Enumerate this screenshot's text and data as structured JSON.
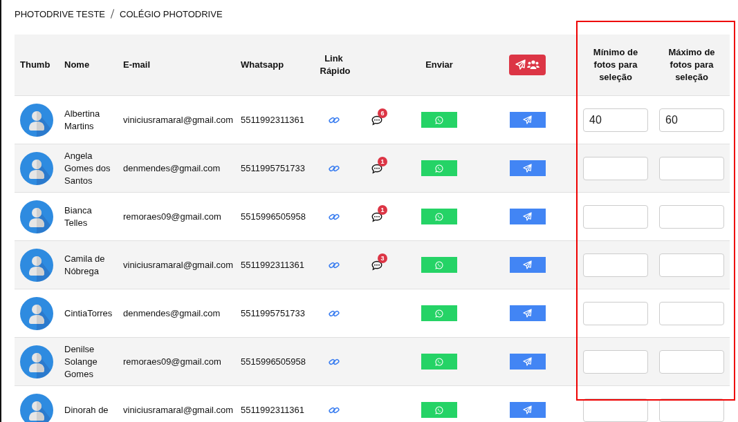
{
  "breadcrumb": [
    "PHOTODRIVE TESTE",
    "COLÉGIO PHOTODRIVE"
  ],
  "table": {
    "columns": [
      "Thumb",
      "Nome",
      "E-mail",
      "Whatsapp",
      "Link Rápido",
      "",
      "Enviar",
      "",
      "Mínimo de fotos para seleção",
      "Máximo de fotos para seleção"
    ],
    "rows": [
      {
        "name": "Albertina Martins",
        "email": "viniciusramaral@gmail.com",
        "whatsapp": "5511992311361",
        "messages": "6",
        "min": "40",
        "max": "60"
      },
      {
        "name": "Angela Gomes dos Santos",
        "email": "denmendes@gmail.com",
        "whatsapp": "5511995751733",
        "messages": "1"
      },
      {
        "name": "Bianca Telles",
        "email": "remoraes09@gmail.com",
        "whatsapp": "5515996505958",
        "messages": "1"
      },
      {
        "name": "Camila de Nóbrega",
        "email": "viniciusramaral@gmail.com",
        "whatsapp": "5511992311361",
        "messages": "3"
      },
      {
        "name": "CintiaTorres",
        "email": "denmendes@gmail.com",
        "whatsapp": "5511995751733"
      },
      {
        "name": "Denilse Solange Gomes",
        "email": "remoraes09@gmail.com",
        "whatsapp": "5515996505958"
      },
      {
        "name": "Dinorah de",
        "email": "viniciusramaral@gmail.com",
        "whatsapp": "5511992311361"
      }
    ]
  }
}
